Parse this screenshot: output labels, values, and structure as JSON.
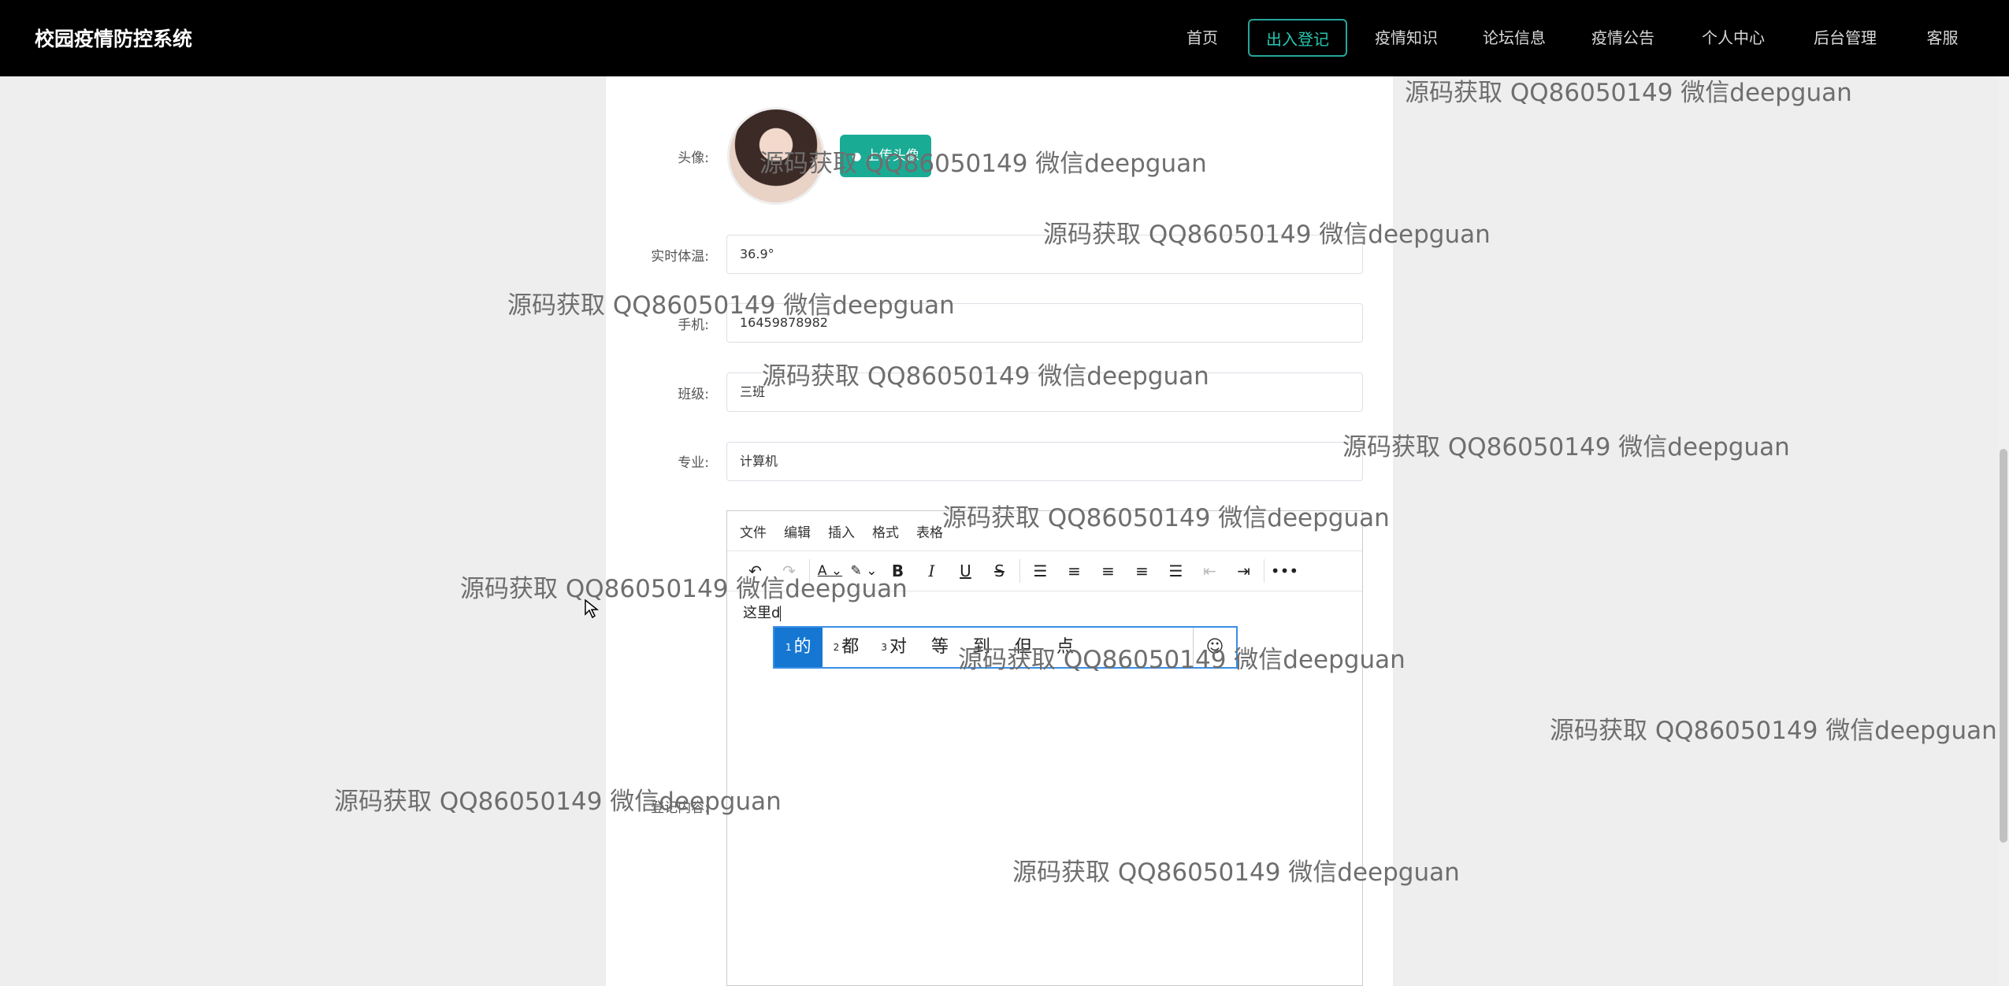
{
  "brand": "校园疫情防控系统",
  "nav": [
    {
      "label": "首页",
      "active": false
    },
    {
      "label": "出入登记",
      "active": true
    },
    {
      "label": "疫情知识",
      "active": false
    },
    {
      "label": "论坛信息",
      "active": false
    },
    {
      "label": "疫情公告",
      "active": false
    },
    {
      "label": "个人中心",
      "active": false
    },
    {
      "label": "后台管理",
      "active": false
    },
    {
      "label": "客服",
      "active": false
    }
  ],
  "form": {
    "avatar_label": "头像:",
    "upload_label": "上传头像",
    "temperature_label": "实时体温:",
    "temperature_value": "36.9°",
    "phone_label": "手机:",
    "phone_value": "16459878982",
    "class_label": "班级:",
    "class_value": "三班",
    "major_label": "专业:",
    "major_value": "计算机",
    "content_label": "登记内容:"
  },
  "editor": {
    "menus": [
      "文件",
      "编辑",
      "插入",
      "格式",
      "表格"
    ],
    "content_text": "这里d"
  },
  "ime": {
    "candidates": [
      {
        "index": "1",
        "text": "的"
      },
      {
        "index": "2",
        "text": "都"
      },
      {
        "index": "3",
        "text": "对"
      },
      {
        "index": "",
        "text": "等"
      },
      {
        "index": "",
        "text": "到"
      },
      {
        "index": "",
        "text": "但"
      },
      {
        "index": "",
        "text": "点"
      }
    ],
    "emoji_icon": "smile-icon"
  },
  "watermark": "源码获取 QQ86050149 微信deepguan",
  "colors": {
    "accent": "#26a69a",
    "navbar": "#000000",
    "ime_selected": "#1677d2"
  }
}
